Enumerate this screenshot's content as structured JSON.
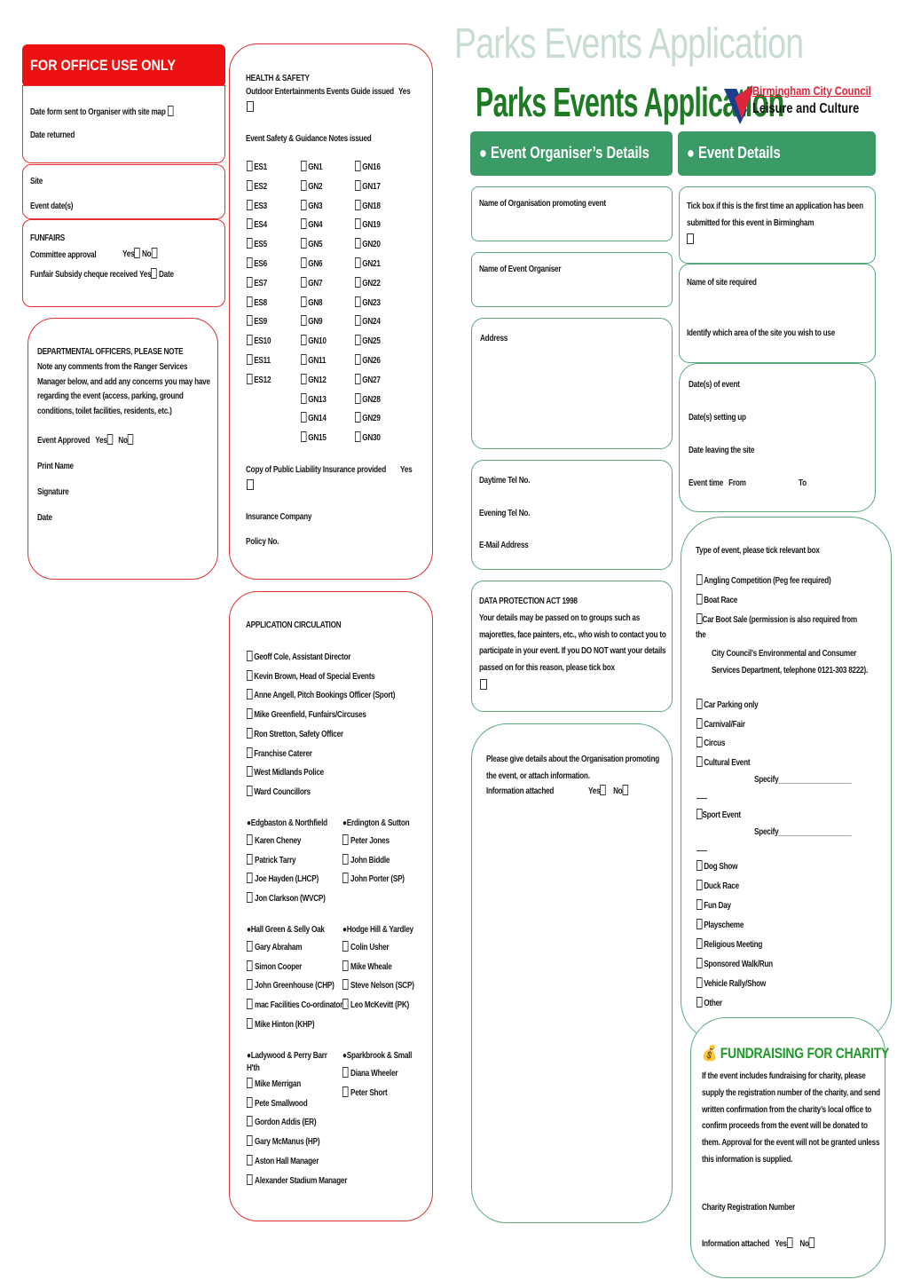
{
  "page": {
    "ghost_title": "Parks Events Application",
    "title": "Parks Events Application",
    "logo": {
      "org": "Birmingham City Council",
      "department": "Leisure and Culture"
    },
    "colors": {
      "office_red": "#ee1111",
      "box_red": "#e23030",
      "header_green": "#3a9b67",
      "box_green": "#5aa97c",
      "title_green": "#1e7a23",
      "logo_red": "#e0243a",
      "logo_blue": "#1c3d8c"
    }
  },
  "office": {
    "header": "FOR OFFICE USE ONLY",
    "date_sent": "Date form sent to Organiser with site map",
    "date_returned": "Date returned",
    "site": "Site",
    "event_dates": "Event date(s)",
    "funfairs": {
      "title": "FUNFAIRS",
      "committee": "Committee approval",
      "yes": "Yes",
      "no": "No",
      "subsidy": "Funfair Subsidy cheque received",
      "subsidy_yes": "Yes",
      "date": "Date"
    },
    "officers": {
      "title": "DEPARTMENTAL OFFICERS, PLEASE NOTE",
      "note": "Note any comments from the Ranger Services Manager below, and add any concerns you may have regarding the event (access, parking, ground conditions, toilet facilities, residents, etc.)",
      "approved": "Event Approved",
      "yes": "Yes",
      "no": "No",
      "print_name": "Print Name",
      "signature": "Signature",
      "date": "Date"
    }
  },
  "health_safety": {
    "title": "HEALTH & SAFETY",
    "guide_issued": "Outdoor Entertainments Events Guide issued",
    "guide_yes": "Yes",
    "notes_issued": "Event Safety & Guidance Notes issued",
    "es": [
      "ES1",
      "ES2",
      "ES3",
      "ES4",
      "ES5",
      "ES6",
      "ES7",
      "ES8",
      "ES9",
      "ES10",
      "ES11",
      "ES12"
    ],
    "gn_a": [
      "GN1",
      "GN2",
      "GN3",
      "GN4",
      "GN5",
      "GN6",
      "GN7",
      "GN8",
      "GN9",
      "GN10",
      "GN11",
      "GN12",
      "GN13",
      "GN14",
      "GN15"
    ],
    "gn_b": [
      "GN16",
      "GN17",
      "GN18",
      "GN19",
      "GN20",
      "GN21",
      "GN22",
      "GN23",
      "GN24",
      "GN25",
      "GN26",
      "GN27",
      "GN28",
      "GN29",
      "GN30"
    ],
    "insurance": "Copy of Public Liability Insurance provided",
    "insurance_yes": "Yes",
    "company": "Insurance Company",
    "policy": "Policy No."
  },
  "circulation": {
    "title": "APPLICATION CIRCULATION",
    "main": [
      "Geoff Cole, Assistant Director",
      "Kevin Brown, Head of Special Events",
      "Anne Angell, Pitch Bookings Officer (Sport)",
      "Mike Greenfield, Funfairs/Circuses",
      "Ron Stretton, Safety Officer",
      "Franchise Caterer",
      "West Midlands Police",
      "Ward Councillors"
    ],
    "groups": [
      {
        "title": "Edgbaston & Northfield",
        "people": [
          "Karen Cheney",
          "Patrick Tarry",
          "Joe Hayden (LHCP)",
          "Jon Clarkson (WVCP)"
        ]
      },
      {
        "title": "Erdington & Sutton",
        "people": [
          "Peter Jones",
          "John Biddle",
          "John Porter (SP)"
        ]
      },
      {
        "title": "Hall Green & Selly Oak",
        "people": [
          "Gary Abraham",
          "Simon Cooper",
          "John Greenhouse (CHP)",
          "mac Facilities Co-ordinator",
          "Mike Hinton (KHP)"
        ]
      },
      {
        "title": "Hodge Hill & Yardley",
        "people": [
          "Colin Usher",
          "Mike Wheale",
          "Steve Nelson (SCP)",
          "Leo McKevitt (PK)"
        ]
      },
      {
        "title": "Ladywood & Perry Barr",
        "title_cont": "H'th",
        "people": [
          "Mike Merrigan",
          "Pete Smallwood",
          "Gordon Addis (ER)",
          "Gary McManus (HP)",
          "Aston Hall Manager",
          "Alexander Stadium Manager"
        ]
      },
      {
        "title": "Sparkbrook & Small",
        "people": [
          "Diana Wheeler",
          "Peter Short"
        ]
      }
    ]
  },
  "organiser": {
    "header": "Event Organiser’s Details",
    "org_name": "Name of Organisation promoting event",
    "organiser_name": "Name of Event Organiser",
    "address": "Address",
    "day_tel": "Daytime Tel No.",
    "eve_tel": "Evening Tel No.",
    "email": "E-Mail Address",
    "dpa_title": "DATA PROTECTION ACT 1998",
    "dpa_text": "Your details may be passed on to groups such as majorettes, face painters, etc., who wish to contact you to participate in your event. If you DO NOT want your details passed on for this reason, please tick box",
    "org_details": "Please give details about the Organisation promoting the event, or attach information.",
    "info_attached": "Information attached",
    "yes": "Yes",
    "no": "No"
  },
  "event": {
    "header": "Event Details",
    "first_time": "Tick box if this is the first time an application has been submitted for this event in Birmingham",
    "site_name": "Name of site required",
    "area": "Identify which area of the site you wish to use",
    "dates": "Date(s) of event",
    "setup": "Date(s) setting up",
    "leaving": "Date leaving the site",
    "time_from": "Event time   From",
    "time_to": "To",
    "types_title": "Type of event, please tick relevant box",
    "types_a": [
      "Angling Competition (Peg fee required)",
      "Boat Race"
    ],
    "car_boot": "Car Boot Sale (permission is also required from",
    "car_boot_the": "the",
    "car_boot_cont": "City Council’s Environmental and Consumer Services Department, telephone 0121-303 8222).",
    "types_b": [
      "Car Parking only",
      "Carnival/Fair",
      "Circus",
      "Cultural Event"
    ],
    "specify": "Specify___________________",
    "sport": "Sport Event",
    "types_c": [
      "Dog Show",
      "Duck Race",
      "Fun Day",
      "Playscheme",
      "Religious Meeting",
      "Sponsored Walk/Run",
      "Vehicle Rally/Show",
      "Other"
    ]
  },
  "charity": {
    "title": "FUNDRAISING FOR CHARITY",
    "text": "If the event includes fundraising for charity, please supply the registration number of the charity, and send written confirmation from the charity’s local office to confirm proceeds from the event will be donated to them. Approval for the event will not be granted unless this information is supplied.",
    "reg_number": "Charity Registration Number",
    "info_attached": "Information attached",
    "yes": "Yes",
    "no": "No"
  }
}
